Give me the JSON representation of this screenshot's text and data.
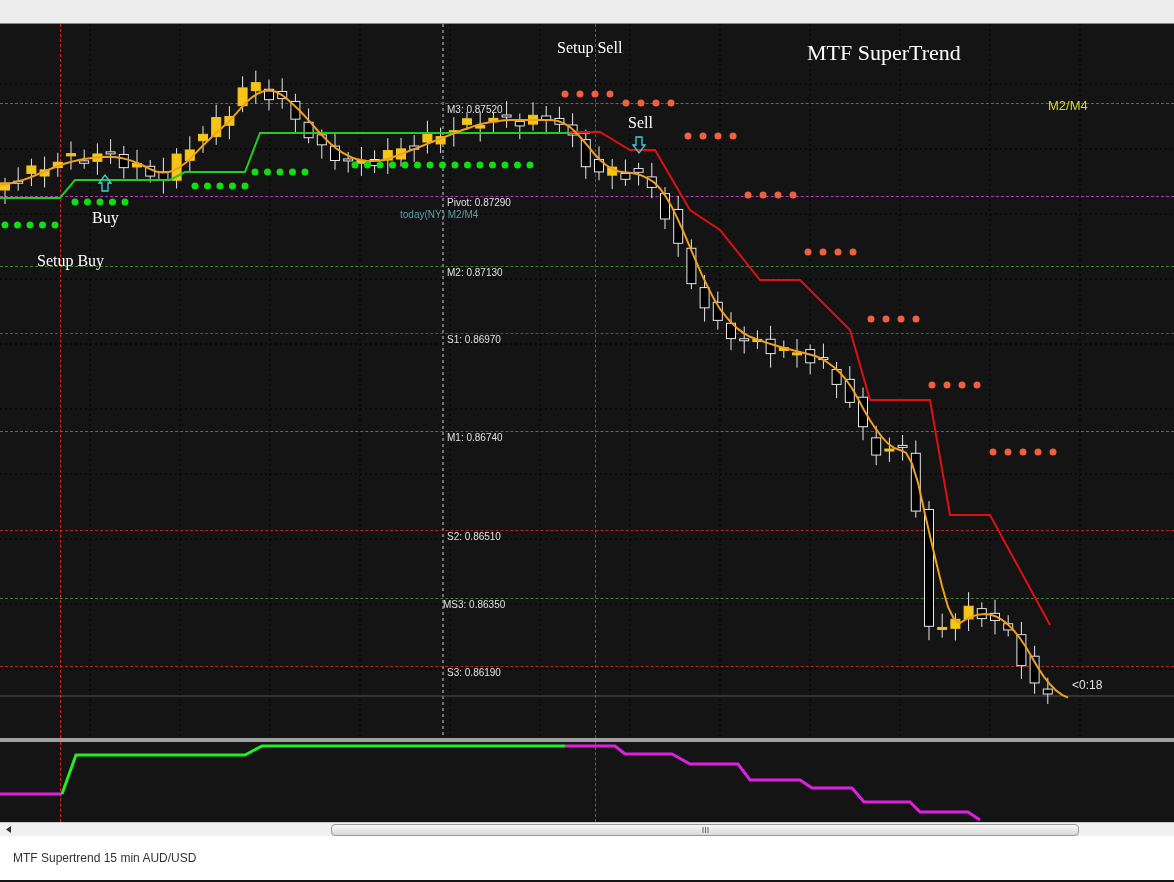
{
  "chart": {
    "title": "MTF SuperTrend",
    "timeframe_label": "M2/M4",
    "pivot_caption": "today(NY) M2/M4",
    "countdown": "<0:18",
    "levels": [
      {
        "label": "M3: 0.87520",
        "color": "#3f7f3f"
      },
      {
        "label": "Pivot: 0.87290",
        "color": "#b040b0"
      },
      {
        "label": "M2: 0.87130",
        "color": "#3f7f3f"
      },
      {
        "label": "S1: 0.86970",
        "color": "#b02828"
      },
      {
        "label": "M1: 0.86740",
        "color": "#3f7f3f"
      },
      {
        "label": "S2: 0.86510",
        "color": "#b02828"
      },
      {
        "label": "MS3: 0.86350",
        "color": "#3f7f3f"
      },
      {
        "label": "S3: 0.86190",
        "color": "#b02828"
      }
    ],
    "signals": [
      {
        "kind": "setup",
        "text": "Setup Buy"
      },
      {
        "kind": "buy",
        "text": "Buy"
      },
      {
        "kind": "setup",
        "text": "Setup Sell"
      },
      {
        "kind": "sell",
        "text": "Sell"
      }
    ]
  },
  "status_bar": {
    "text": "MTF Supertrend 15 min AUD/USD"
  }
}
